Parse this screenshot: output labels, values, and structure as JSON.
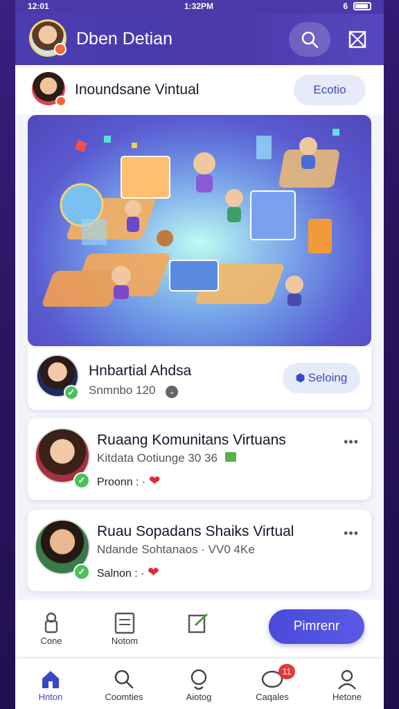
{
  "status_bar": {
    "left": "12:01",
    "time": "1:32PM",
    "right": "6"
  },
  "header": {
    "title": "Dben Detian"
  },
  "top_row": {
    "name": "Inoundsane Vintual",
    "button": "Ecotio"
  },
  "cards": [
    {
      "title": "Hnbartial Ahdsa",
      "subtitle": "Snmnbo  120",
      "button": "Seloing"
    },
    {
      "title": "Ruaang Komunitans Virtuans",
      "subtitle": "Kitdata Ootiunge 30  36",
      "meta": "Proonn : ·"
    },
    {
      "title": "Ruau Sopadans  Shaiks Virtual",
      "subtitle": "Ndande Sohtanaos · VV0 4Ke",
      "meta": "Salnon : ·"
    }
  ],
  "action_bar": {
    "items": [
      {
        "label": "Cone",
        "icon": "chef-icon"
      },
      {
        "label": "Notom",
        "icon": "notes-icon"
      },
      {
        "label": "",
        "icon": "edit-icon"
      }
    ],
    "primary": "Pimrenr"
  },
  "bottom_nav": {
    "items": [
      {
        "label": "Hnton",
        "icon": "home-icon"
      },
      {
        "label": "Coomties",
        "icon": "search-icon"
      },
      {
        "label": "Aiotog",
        "icon": "location-icon"
      },
      {
        "label": "Caqales",
        "icon": "chat-icon",
        "badge": "11"
      },
      {
        "label": "Hetone",
        "icon": "profile-icon"
      }
    ]
  },
  "colors": {
    "primary": "#4a3aa8",
    "accent": "#3a48c8",
    "like": "#e0283a",
    "online": "#4cc05a"
  }
}
